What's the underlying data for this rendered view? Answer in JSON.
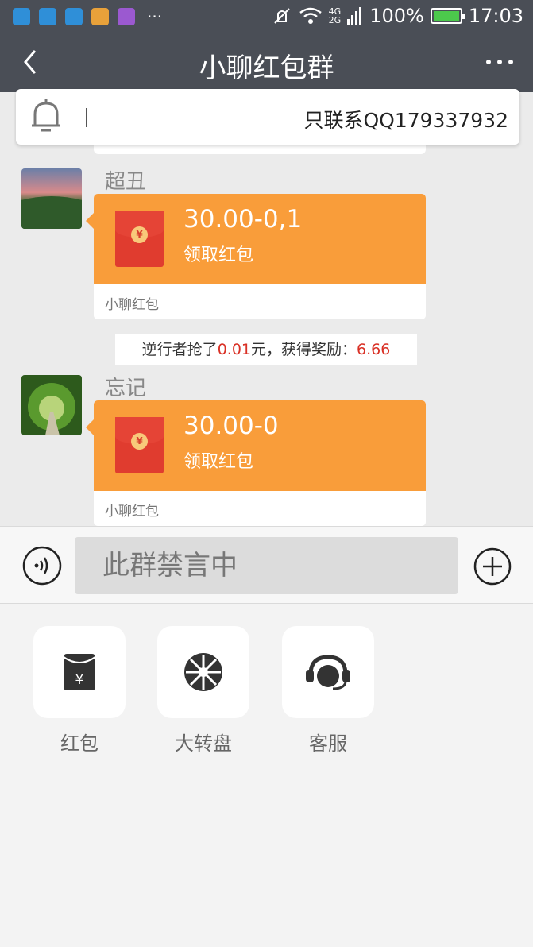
{
  "status_bar": {
    "signal_top": "4G",
    "signal_bottom": "2G",
    "battery": "100%",
    "time": "17:03",
    "more": "···"
  },
  "header": {
    "title": "小聊红包群"
  },
  "notice": {
    "text": "只联系QQ179337932"
  },
  "messages": [
    {
      "sender": "超丑",
      "amount": "30.00-0,1",
      "action": "领取红包",
      "footer": "小聊红包"
    },
    {
      "sender": "忘记",
      "amount": "30.00-0",
      "action": "领取红包",
      "footer": "小聊红包"
    }
  ],
  "system_message": {
    "prefix": "逆行者抢了",
    "amount": "0.01",
    "middle": "元，获得奖励：",
    "reward": "6.66"
  },
  "input": {
    "muted_text": "此群禁言中"
  },
  "tools": [
    {
      "label": "红包"
    },
    {
      "label": "大转盘"
    },
    {
      "label": "客服"
    }
  ],
  "colors": {
    "header_bg": "#4a4e56",
    "red_packet": "#f99d3a",
    "envelope": "#e03c2f",
    "highlight_red": "#d93025"
  }
}
